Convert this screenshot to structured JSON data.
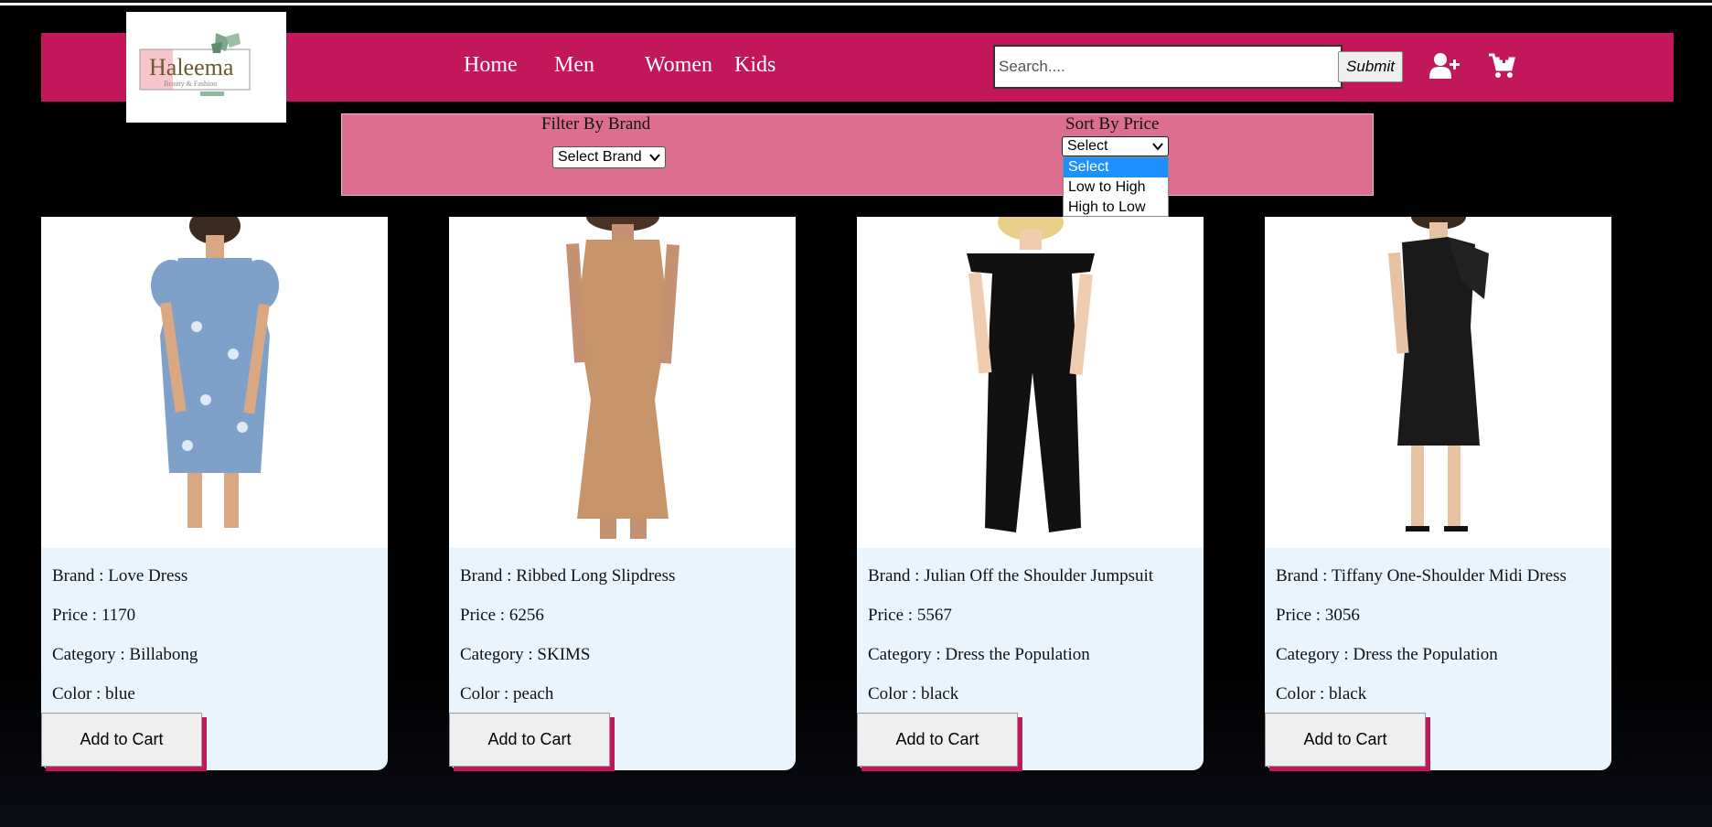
{
  "brand": {
    "logo_title": "Haleema",
    "logo_subtitle": "Beauty & Fashion"
  },
  "nav": {
    "links": [
      "Home",
      "Men",
      "Women",
      "Kids"
    ]
  },
  "search": {
    "placeholder": "Search....",
    "value": "",
    "submit_label": "Submit"
  },
  "icons": {
    "add_user": "user-plus-icon",
    "cart": "cart-plus-icon"
  },
  "filters": {
    "brand_label": "Filter By Brand",
    "brand_selected": "Select Brand",
    "price_label": "Sort By Price",
    "price_selected": "Select",
    "price_options": [
      "Select",
      "Low to High",
      "High to Low"
    ],
    "price_highlighted": "Select"
  },
  "products": [
    {
      "brand": "Brand : Love Dress",
      "price": "Price : 1170",
      "category": "Category : Billabong",
      "color": "Color : blue",
      "add_label": "Add to Cart",
      "swatch": "#7ea0c9"
    },
    {
      "brand": "Brand : Ribbed Long Slipdress",
      "price": "Price : 6256",
      "category": "Category : SKIMS",
      "color": "Color : peach",
      "add_label": "Add to Cart",
      "swatch": "#c8956a"
    },
    {
      "brand": "Brand : Julian Off the Shoulder Jumpsuit",
      "price": "Price : 5567",
      "category": "Category : Dress the Population",
      "color": "Color : black",
      "add_label": "Add to Cart",
      "swatch": "#111111"
    },
    {
      "brand": "Brand : Tiffany One-Shoulder Midi Dress",
      "price": "Price : 3056",
      "category": "Category : Dress the Population",
      "color": "Color : black",
      "add_label": "Add to Cart",
      "swatch": "#1a1a1a"
    }
  ],
  "colors": {
    "accent": "#c2185b",
    "filter_panel": "#dc6f8f",
    "card_bg": "#eaf4fd",
    "dropdown_highlight": "#1e90ff"
  }
}
